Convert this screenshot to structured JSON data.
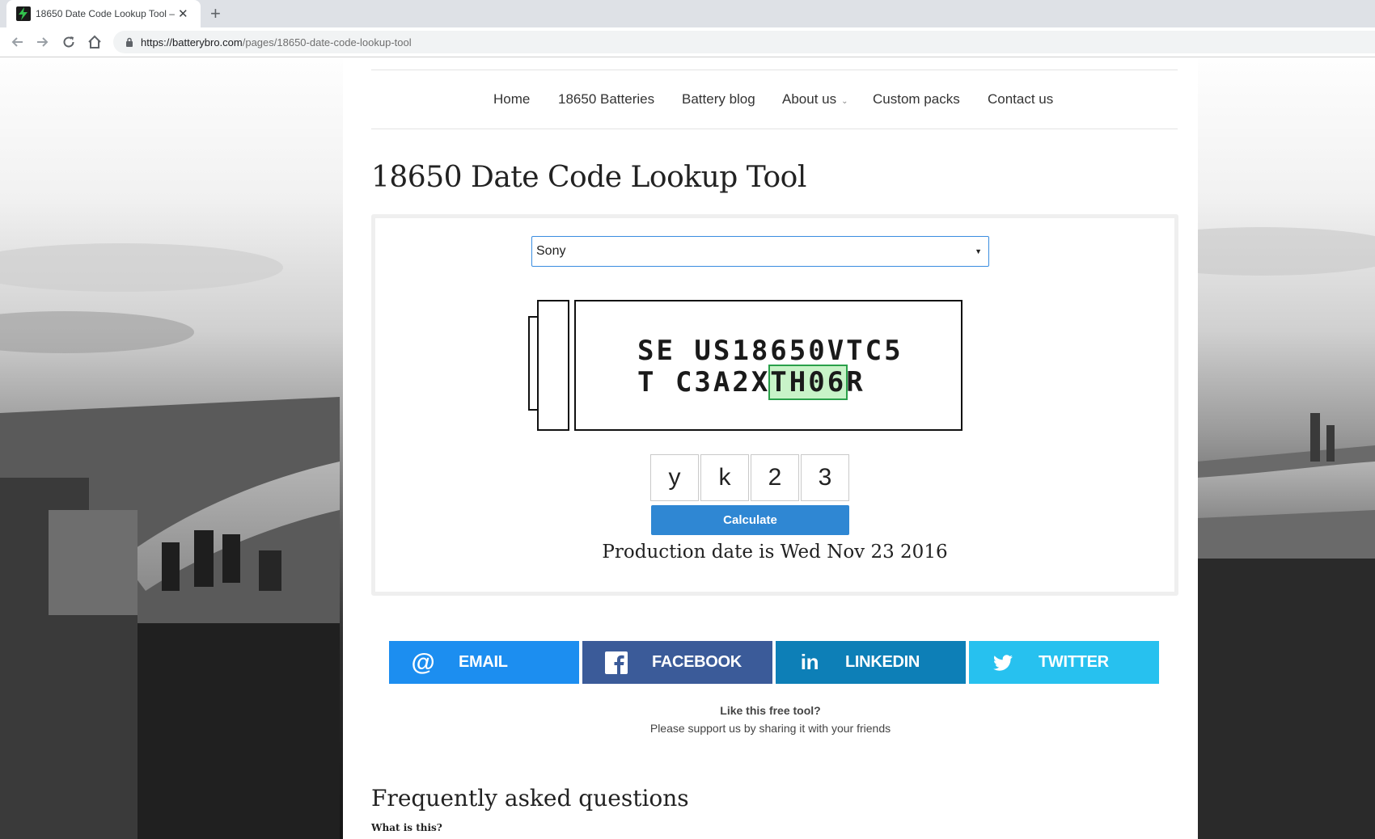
{
  "browser": {
    "tab_title": "18650 Date Code Lookup Tool –",
    "new_tab": "+",
    "close": "✕",
    "url_host": "https://batterybro.com",
    "url_path": "/pages/18650-date-code-lookup-tool"
  },
  "nav": {
    "items": [
      {
        "label": "Home"
      },
      {
        "label": "18650 Batteries"
      },
      {
        "label": "Battery blog"
      },
      {
        "label": "About us"
      },
      {
        "label": "Custom packs"
      },
      {
        "label": "Contact us"
      }
    ],
    "dropdown_caret": "⌄"
  },
  "page": {
    "title": "18650 Date Code Lookup Tool"
  },
  "tool": {
    "brand_selected": "Sony",
    "caret": "▼",
    "code_line1": "SE US18650VTC5",
    "code_line2_prefix": "T C3A2X",
    "code_line2_highlight": "TH06",
    "code_line2_suffix": "R",
    "digits": [
      "y",
      "k",
      "2",
      "3"
    ],
    "calculate_label": "Calculate",
    "result": "Production date is Wed Nov 23 2016"
  },
  "share": {
    "email_label": "EMAIL",
    "facebook_label": "FACEBOOK",
    "linkedin_label": "LINKEDIN",
    "twitter_label": "TWITTER",
    "email_color": "#1c8ef0",
    "facebook_color": "#3b5b99",
    "linkedin_color": "#0d7fb7",
    "twitter_color": "#27c1ef",
    "prompt": "Like this free tool?",
    "support": "Please support us by sharing it with your friends"
  },
  "faq": {
    "title": "Frequently asked questions",
    "first_question": "What is this?"
  }
}
